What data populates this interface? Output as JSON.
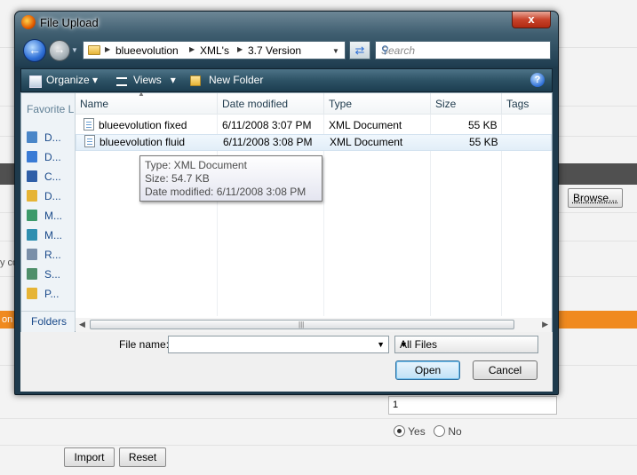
{
  "background": {
    "browse_label": "Browse...",
    "field_value": "1",
    "partial_text_left_1": "y co",
    "partial_text_left_2": "on",
    "yes_label": "Yes",
    "no_label": "No",
    "import_label": "Import",
    "reset_label": "Reset"
  },
  "dialog": {
    "title": "File Upload",
    "close_label": "x",
    "path": [
      "blueevolution",
      "XML's",
      "3.7 Version"
    ],
    "search_placeholder": "Search",
    "toolbar": {
      "organize": "Organize",
      "views": "Views",
      "new_folder": "New Folder",
      "help": "?"
    },
    "nav": {
      "header": "Favorite Links",
      "items": [
        {
          "label": "D...",
          "icon": "documents-icon",
          "color": "#4a86c8"
        },
        {
          "label": "D...",
          "icon": "desktop-icon",
          "color": "#3a7bd5"
        },
        {
          "label": "C...",
          "icon": "computer-icon",
          "color": "#2f5fa8"
        },
        {
          "label": "D...",
          "icon": "folder-icon",
          "color": "#e6b435"
        },
        {
          "label": "M...",
          "icon": "music-icon",
          "color": "#3c9a6a"
        },
        {
          "label": "M...",
          "icon": "music-icon",
          "color": "#2f8fb0"
        },
        {
          "label": "R...",
          "icon": "recent-icon",
          "color": "#7a8fa8"
        },
        {
          "label": "S...",
          "icon": "searches-icon",
          "color": "#4f8f6a"
        },
        {
          "label": "P...",
          "icon": "folder-icon",
          "color": "#e6b435"
        }
      ],
      "folders": "Folders"
    },
    "columns": [
      "Name",
      "Date modified",
      "Type",
      "Size",
      "Tags"
    ],
    "files": [
      {
        "name": "blueevolution fixed",
        "date": "6/11/2008 3:07 PM",
        "type": "XML Document",
        "size": "55 KB",
        "tags": ""
      },
      {
        "name": "blueevolution fluid",
        "date": "6/11/2008 3:08 PM",
        "type": "XML Document",
        "size": "55 KB",
        "tags": ""
      }
    ],
    "tooltip": {
      "type": "Type: XML Document",
      "size": "Size: 54.7 KB",
      "date": "Date modified: 6/11/2008 3:08 PM"
    },
    "file_name_label": "File name:",
    "file_name_value": "",
    "file_type": "All Files",
    "open_label": "Open",
    "cancel_label": "Cancel"
  }
}
